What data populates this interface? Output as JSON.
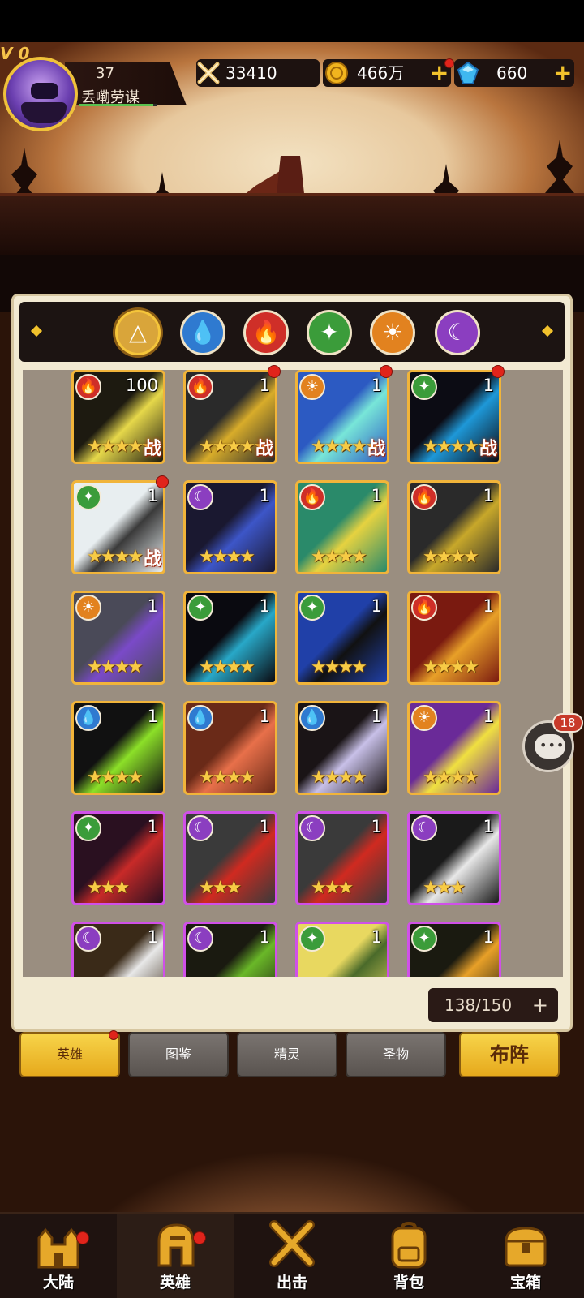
{
  "header": {
    "vip": "V 0",
    "level": "37",
    "player_name": "丢嘞劳谋",
    "xp_fraction": 0.95,
    "power": "33410",
    "gold": "466万",
    "gems": "660",
    "plus": "+"
  },
  "elements": [
    {
      "name": "light",
      "symbol": "△",
      "color": "#d9a53a",
      "active": true
    },
    {
      "name": "water",
      "symbol": "💧",
      "color": "#2f7ad0"
    },
    {
      "name": "fire",
      "symbol": "🔥",
      "color": "#cf2f28"
    },
    {
      "name": "wind",
      "symbol": "✦",
      "color": "#3b9c3a"
    },
    {
      "name": "sun",
      "symbol": "☀",
      "color": "#e2821f"
    },
    {
      "name": "dark",
      "symbol": "☾",
      "color": "#8b3ec0"
    }
  ],
  "heroes": [
    {
      "element": "fire",
      "level": "100",
      "stars": "★★★★★",
      "tag": "战",
      "dot": false,
      "frame": "gold",
      "colors": [
        "#1d1a10",
        "#e6d84a"
      ]
    },
    {
      "element": "fire",
      "level": "1",
      "stars": "★★★★★",
      "tag": "战",
      "dot": true,
      "frame": "gold",
      "colors": [
        "#2a2a2a",
        "#d8ac2a"
      ]
    },
    {
      "element": "sun",
      "level": "1",
      "stars": "★★★★★",
      "tag": "战",
      "dot": true,
      "frame": "gold",
      "colors": [
        "#2c5ac2",
        "#78e6d8"
      ]
    },
    {
      "element": "wind",
      "level": "1",
      "stars": "★★★★★",
      "tag": "战",
      "dot": true,
      "frame": "gold",
      "colors": [
        "#0c0c14",
        "#1e98d8"
      ]
    },
    {
      "element": "wind",
      "level": "1",
      "stars": "★★★★",
      "tag": "战",
      "dot": true,
      "frame": "gold",
      "colors": [
        "#e8eef0",
        "#3a3a3a"
      ]
    },
    {
      "element": "dark",
      "level": "1",
      "stars": "★★★★",
      "tag": "",
      "dot": false,
      "frame": "gold",
      "colors": [
        "#1a1830",
        "#3d56c8"
      ]
    },
    {
      "element": "fire",
      "level": "1",
      "stars": "★★★★",
      "tag": "",
      "dot": false,
      "frame": "gold",
      "colors": [
        "#2a8a6a",
        "#e6d240"
      ]
    },
    {
      "element": "fire",
      "level": "1",
      "stars": "★★★★",
      "tag": "",
      "dot": false,
      "frame": "gold",
      "colors": [
        "#2a2a2a",
        "#c8a82a"
      ]
    },
    {
      "element": "sun",
      "level": "1",
      "stars": "★★★★",
      "tag": "",
      "dot": false,
      "frame": "gold",
      "colors": [
        "#4a4a58",
        "#7a4ac8"
      ]
    },
    {
      "element": "wind",
      "level": "1",
      "stars": "★★★★",
      "tag": "",
      "dot": false,
      "frame": "gold",
      "colors": [
        "#0a0a10",
        "#28a8c8"
      ]
    },
    {
      "element": "wind",
      "level": "1",
      "stars": "★★★★",
      "tag": "",
      "dot": false,
      "frame": "gold",
      "colors": [
        "#2040a8",
        "#111111"
      ]
    },
    {
      "element": "fire",
      "level": "1",
      "stars": "★★★★",
      "tag": "",
      "dot": false,
      "frame": "gold",
      "colors": [
        "#7a1a10",
        "#e8a028"
      ]
    },
    {
      "element": "water",
      "level": "1",
      "stars": "★★★★",
      "tag": "",
      "dot": false,
      "frame": "gold",
      "colors": [
        "#111111",
        "#8ce028"
      ]
    },
    {
      "element": "water",
      "level": "1",
      "stars": "★★★★",
      "tag": "",
      "dot": false,
      "frame": "gold",
      "colors": [
        "#6a2a18",
        "#e8704a"
      ]
    },
    {
      "element": "water",
      "level": "1",
      "stars": "★★★★",
      "tag": "",
      "dot": false,
      "frame": "gold",
      "colors": [
        "#1a1416",
        "#c8c0e8"
      ]
    },
    {
      "element": "sun",
      "level": "1",
      "stars": "★★★★",
      "tag": "",
      "dot": false,
      "frame": "gold",
      "colors": [
        "#6a2a98",
        "#f0e040"
      ]
    },
    {
      "element": "wind",
      "level": "1",
      "stars": "★★★",
      "tag": "",
      "dot": false,
      "frame": "purple",
      "colors": [
        "#2a1020",
        "#c82a28"
      ]
    },
    {
      "element": "dark",
      "level": "1",
      "stars": "★★★",
      "tag": "",
      "dot": false,
      "frame": "purple",
      "colors": [
        "#3a3a3a",
        "#d02a20"
      ]
    },
    {
      "element": "dark",
      "level": "1",
      "stars": "★★★",
      "tag": "",
      "dot": false,
      "frame": "purple",
      "colors": [
        "#3a3a3a",
        "#d02a20"
      ]
    },
    {
      "element": "dark",
      "level": "1",
      "stars": "★★★",
      "tag": "",
      "dot": false,
      "frame": "purple",
      "colors": [
        "#1a1a1a",
        "#e8e8e8"
      ]
    },
    {
      "element": "dark",
      "level": "1",
      "stars": "★★★",
      "tag": "",
      "dot": false,
      "frame": "purple",
      "colors": [
        "#3a2a18",
        "#e8e8e8"
      ]
    },
    {
      "element": "dark",
      "level": "1",
      "stars": "★★★",
      "tag": "",
      "dot": false,
      "frame": "purple",
      "colors": [
        "#1a1a10",
        "#6ab828"
      ]
    },
    {
      "element": "wind",
      "level": "1",
      "stars": "★★★",
      "tag": "",
      "dot": false,
      "frame": "purple",
      "colors": [
        "#e8d860",
        "#4a6a2a"
      ]
    },
    {
      "element": "wind",
      "level": "1",
      "stars": "★★★",
      "tag": "",
      "dot": false,
      "frame": "purple",
      "colors": [
        "#1a1a10",
        "#e8a028"
      ]
    }
  ],
  "capacity": {
    "text": "138/150",
    "plus": "+"
  },
  "chat": {
    "count": "18",
    "dots": "•••"
  },
  "subtabs": {
    "heroes": "英雄",
    "codex": "图鉴",
    "spirit": "精灵",
    "relic": "圣物",
    "formation": "布阵"
  },
  "nav": {
    "continent": "大陆",
    "heroes": "英雄",
    "battle": "出击",
    "bag": "背包",
    "chest": "宝箱"
  }
}
